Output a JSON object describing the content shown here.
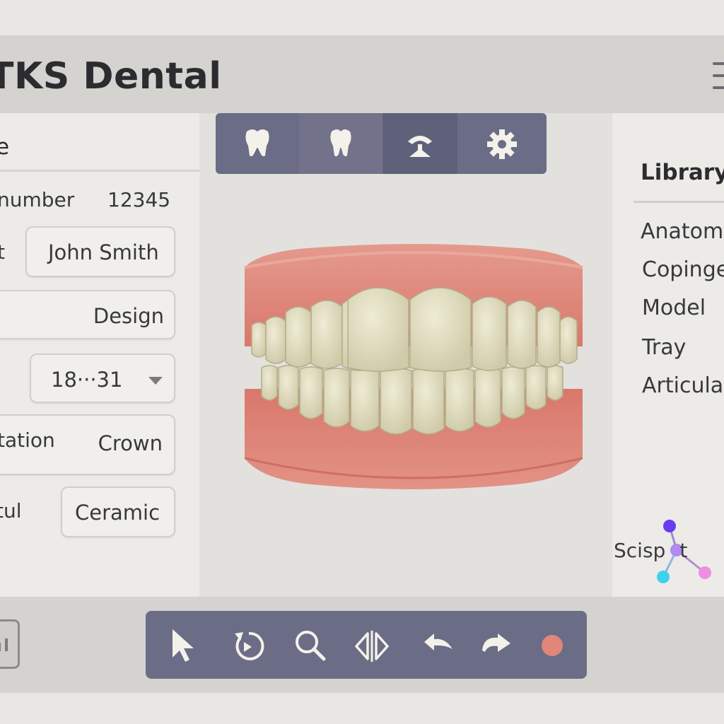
{
  "app": {
    "title": "TKS Dental"
  },
  "left_panel": {
    "heading": "e",
    "rows": [
      {
        "label": "number",
        "value": "12345"
      },
      {
        "label": "t",
        "value": "John Smith"
      },
      {
        "label": "",
        "value": "Design"
      },
      {
        "label": "",
        "value": "18···31"
      },
      {
        "label": "tation",
        "value": "Crown"
      },
      {
        "label": "tul",
        "value": "Ceramic"
      }
    ]
  },
  "top_toolbar": {
    "buttons": [
      {
        "icon": "tooth-icon"
      },
      {
        "icon": "tooth-outline-icon"
      },
      {
        "icon": "arch-icon"
      },
      {
        "icon": "gear-icon"
      }
    ]
  },
  "right_panel": {
    "title": "Library",
    "items": [
      "Anatom",
      "Copinge",
      "Model",
      "Tray",
      "Articula"
    ]
  },
  "logo": {
    "text_left": "Scisp",
    "text_right": "t"
  },
  "bottom_toolbar": {
    "buttons": [
      {
        "icon": "cursor-icon"
      },
      {
        "icon": "rotate-icon"
      },
      {
        "icon": "zoom-icon"
      },
      {
        "icon": "mirror-icon"
      },
      {
        "icon": "undo-icon"
      },
      {
        "icon": "redo-icon"
      },
      {
        "icon": "record-icon"
      }
    ]
  },
  "colors": {
    "toolbar": "#6b6c85",
    "gum": "#e0897e",
    "tooth": "#e6e3cb",
    "record": "#e0867a"
  }
}
